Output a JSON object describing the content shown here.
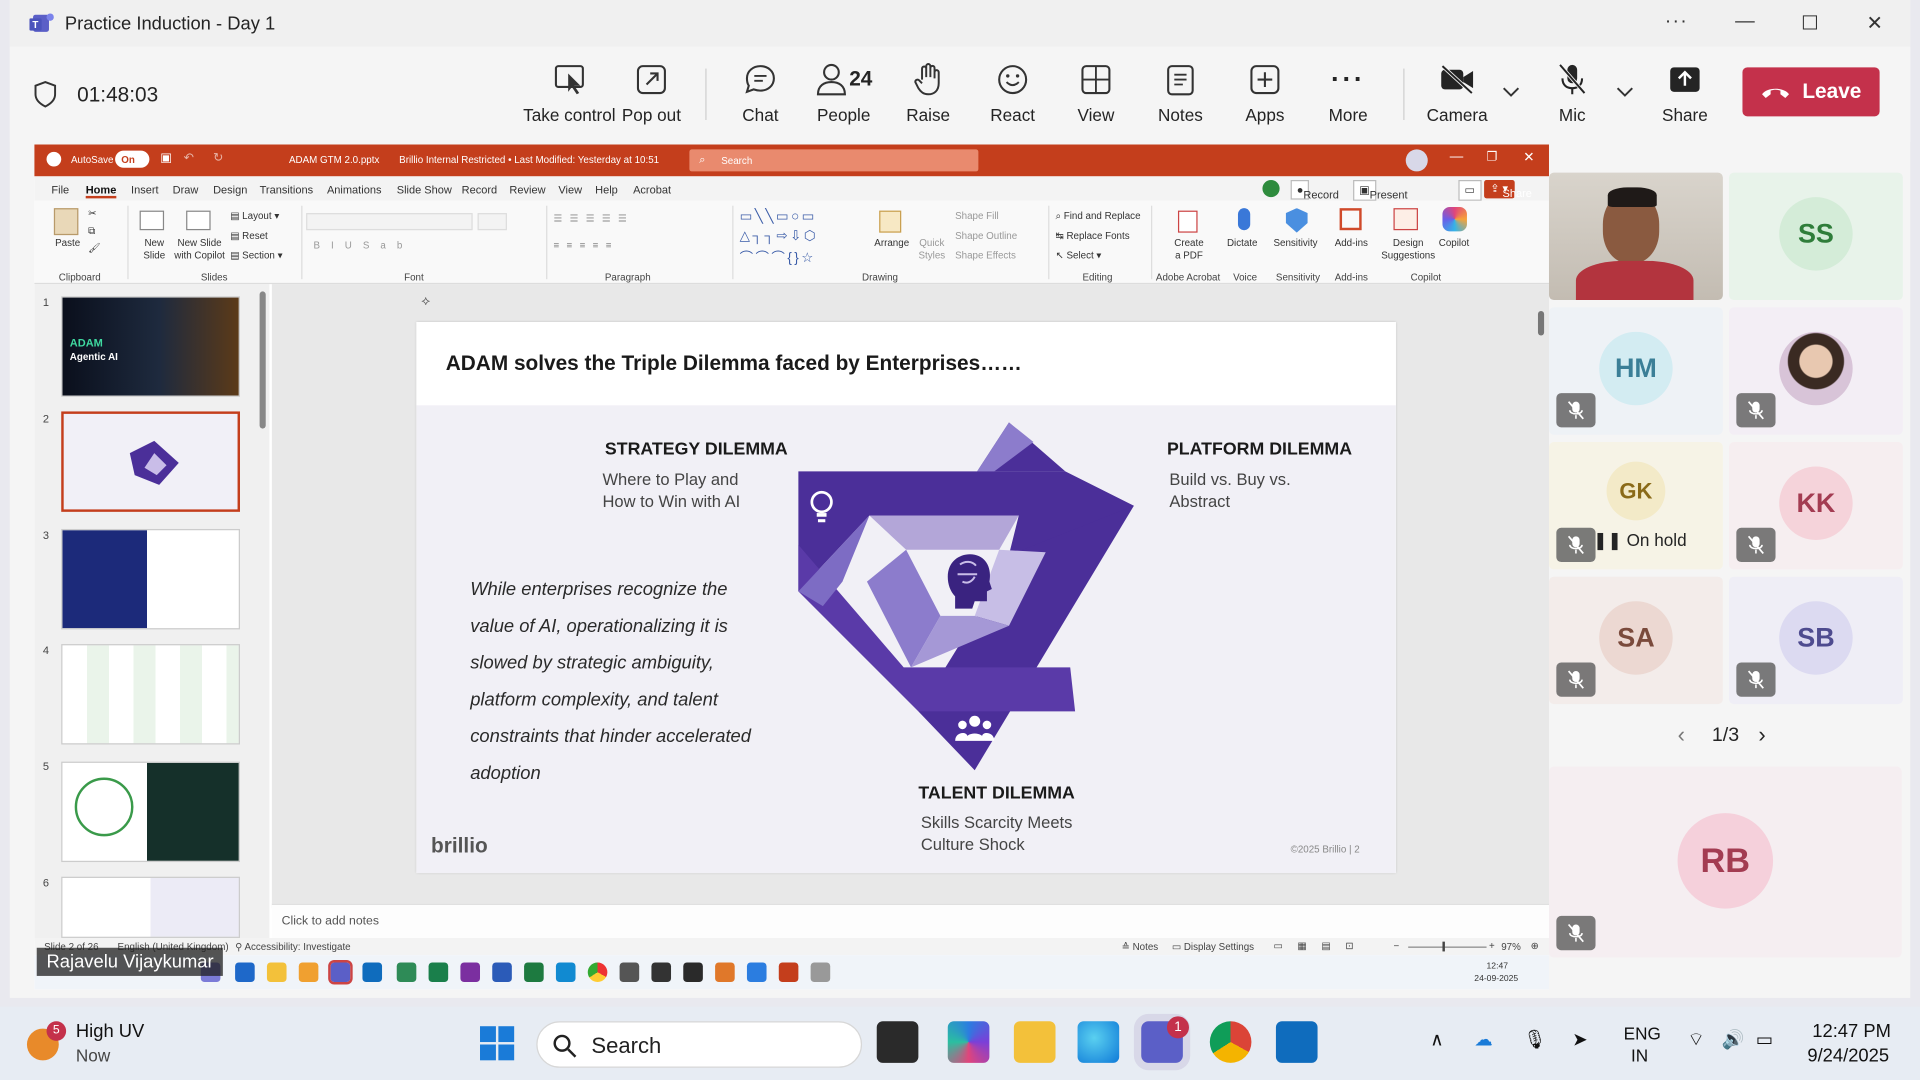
{
  "window": {
    "title": "Practice Induction - Day 1"
  },
  "meeting": {
    "timer": "01:48:03",
    "take_control": "Take control",
    "pop_out": "Pop out",
    "chat": "Chat",
    "people_count": "24",
    "people": "People",
    "raise": "Raise",
    "react": "React",
    "view": "View",
    "notes": "Notes",
    "apps": "Apps",
    "more": "More",
    "camera": "Camera",
    "mic": "Mic",
    "share": "Share",
    "leave": "Leave"
  },
  "ppt": {
    "autosave": "AutoSave",
    "autosave_state": "On",
    "filename": "ADAM GTM 2.0.pptx",
    "sensitivity": "Brillio Internal Restricted • Last Modified: Yesterday at 10:51",
    "search": "Search",
    "menu": [
      "File",
      "Home",
      "Insert",
      "Draw",
      "Design",
      "Transitions",
      "Animations",
      "Slide Show",
      "Record",
      "Review",
      "View",
      "Help",
      "Acrobat"
    ],
    "record_btn": "Record",
    "present_btn": "Present in Teams",
    "share_btn": "Share",
    "ribbon": {
      "paste": "Paste",
      "new_slide": "New Slide",
      "new_slide_copilot": "New Slide with Copilot",
      "layout": "Layout",
      "reset": "Reset",
      "section": "Section",
      "arrange": "Arrange",
      "quick_styles": "Quick Styles",
      "shape_fill": "Shape Fill",
      "shape_outline": "Shape Outline",
      "shape_effects": "Shape Effects",
      "find_replace": "Find and Replace",
      "replace_fonts": "Replace Fonts",
      "select": "Select",
      "create_pdf": "Create a PDF",
      "dictate": "Dictate",
      "sensitivity": "Sensitivity",
      "addins": "Add-ins",
      "design_suggestions": "Design Suggestions",
      "copilot": "Copilot",
      "groups": [
        "Clipboard",
        "Slides",
        "Font",
        "Paragraph",
        "Drawing",
        "Editing",
        "Adobe Acrobat",
        "Voice",
        "Sensitivity",
        "Add-ins",
        "Copilot"
      ]
    },
    "thumb1_title": "ADAM",
    "thumb1_sub": "Agentic AI",
    "thumb_numbers": [
      "1",
      "2",
      "3",
      "4",
      "5",
      "6"
    ],
    "notes_placeholder": "Click to add notes",
    "status": {
      "slide": "Slide 2 of 26",
      "lang": "English (United Kingdom)",
      "access": "Accessibility: Investigate",
      "notes": "Notes",
      "display": "Display Settings",
      "zoom": "97%"
    },
    "clock_time": "12:47",
    "clock_date": "24-09-2025"
  },
  "slide": {
    "title": "ADAM solves the Triple Dilemma faced by Enterprises……",
    "strategy_title": "STRATEGY DILEMMA",
    "strategy_l1": "Where to Play and",
    "strategy_l2": "How to Win with AI",
    "platform_title": "PLATFORM DILEMMA",
    "platform_l1": "Build vs. Buy vs.",
    "platform_l2": "Abstract",
    "body": [
      "While enterprises recognize the",
      "value of AI, operationalizing it is",
      "slowed by strategic ambiguity,",
      "platform complexity, and talent",
      "constraints that hinder accelerated",
      "adoption"
    ],
    "talent_title": "TALENT DILEMMA",
    "talent_l1": "Skills Scarcity Meets",
    "talent_l2": "Culture Shock",
    "logo": "brillio",
    "footer": "©2025 Brillio  |  2"
  },
  "presenter": "Rajavelu Vijaykumar",
  "gallery": {
    "participants": [
      {
        "initials": "SS",
        "bg": "#e8f3ea",
        "avbg": "#d4ecd8",
        "fg": "#2f7d3a"
      },
      {
        "initials": "HM",
        "bg": "#eef2f6",
        "avbg": "#d3ecf2",
        "fg": "#3b7f97"
      },
      {
        "initials": "GK",
        "bg": "#f6f3e6",
        "avbg": "#f3eac8",
        "fg": "#8a6a18"
      },
      {
        "initials": "KK",
        "bg": "#f6eef0",
        "avbg": "#f5d3da",
        "fg": "#a33c52"
      },
      {
        "initials": "SA",
        "bg": "#f3ecea",
        "avbg": "#ecd8d2",
        "fg": "#7a4a3c"
      },
      {
        "initials": "SB",
        "bg": "#efeef6",
        "avbg": "#dcdaf1",
        "fg": "#4e4b8f"
      },
      {
        "initials": "RB",
        "bg": "#f5eef1",
        "avbg": "#f5d0db",
        "fg": "#a33c52"
      }
    ],
    "on_hold": "On hold",
    "page": "1/3"
  },
  "taskbar": {
    "weather_badge": "5",
    "weather_title": "High UV",
    "weather_sub": "Now",
    "search": "Search",
    "teams_badge": "1",
    "lang1": "ENG",
    "lang2": "IN",
    "time": "12:47 PM",
    "date": "9/24/2025"
  },
  "colors": {
    "leave": "#c4314b",
    "ppt_accent": "#c43e1c",
    "slide_purple": "#4b2f99"
  }
}
